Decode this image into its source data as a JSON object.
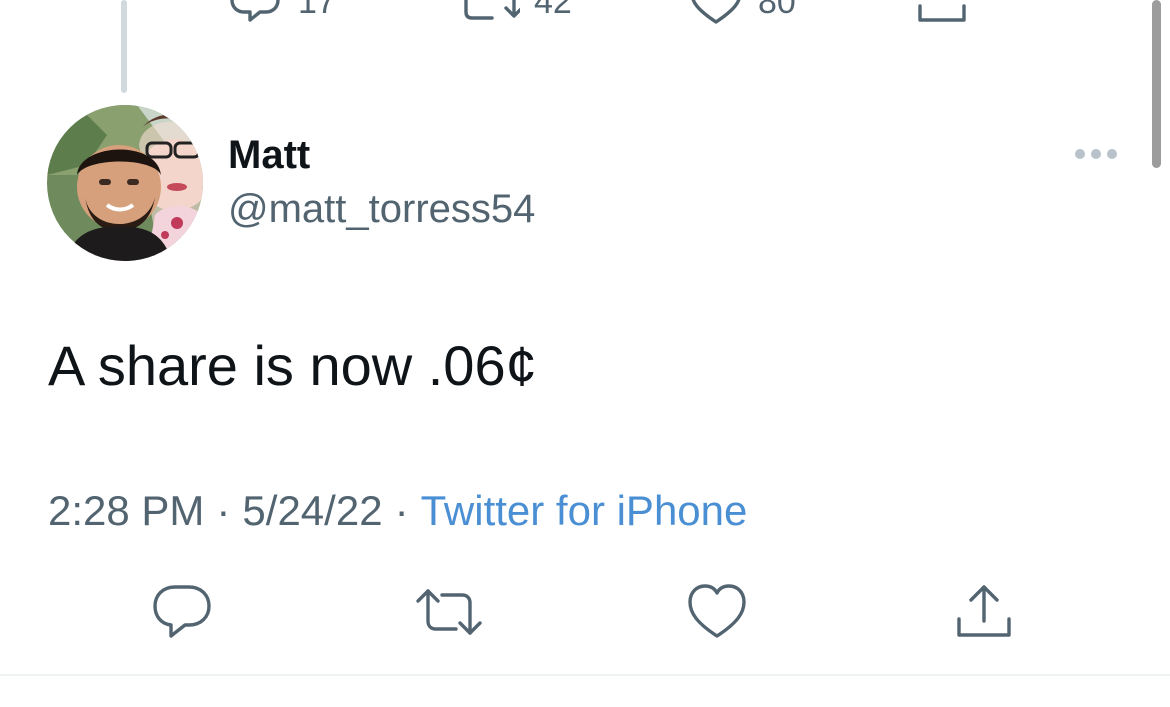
{
  "previous_tweet": {
    "reply_count": "17",
    "retweet_count": "42",
    "like_count": "80"
  },
  "tweet": {
    "author_name": "Matt",
    "author_handle": "@matt_torress54",
    "text": "A share is now .06¢",
    "time": "2:28 PM",
    "date": "5/24/22",
    "separator": "·",
    "source": "Twitter for iPhone"
  },
  "icons": {
    "reply": "reply-icon",
    "retweet": "retweet-icon",
    "like": "heart-icon",
    "share": "share-icon",
    "more": "more-icon"
  },
  "colors": {
    "text_primary": "#0f1419",
    "text_secondary": "#536471",
    "link": "#4a8fd4",
    "thread_line": "#cfd9de"
  }
}
